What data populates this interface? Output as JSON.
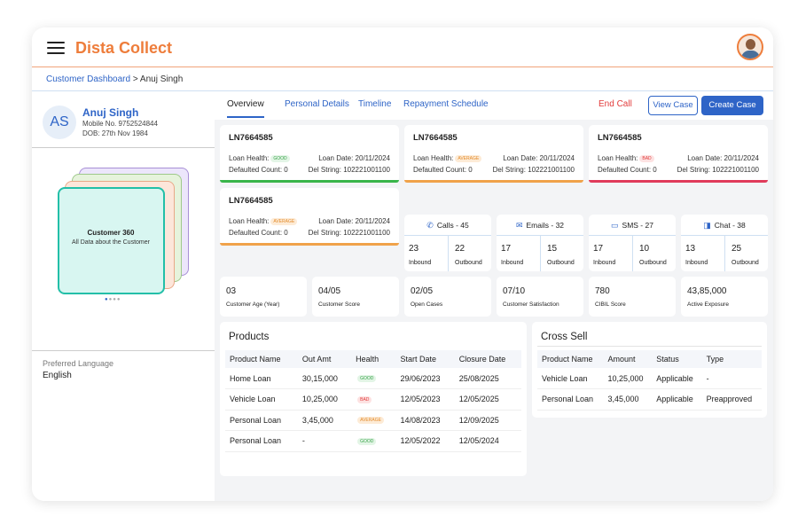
{
  "app": {
    "title": "Dista Collect"
  },
  "breadcrumb": {
    "link": "Customer Dashboard",
    "sep": " > ",
    "current": "Anuj Singh"
  },
  "customer": {
    "initials": "AS",
    "name": "Anuj Singh",
    "mobile": "Mobile No. 9752524844",
    "dob": "DOB: 27th Nov 1984"
  },
  "card360": {
    "title": "Customer 360",
    "subtitle": "All Data about the Customer"
  },
  "preferred_language": {
    "label": "Preferred Language",
    "value": "English"
  },
  "tabs": [
    "Overview",
    "Personal Details",
    "Timeline",
    "Repayment Schedule"
  ],
  "actions": {
    "end_call": "End Call",
    "view_case": "View Case",
    "create_case": "Create Case"
  },
  "loans": [
    {
      "id": "LN7664585",
      "health_label": "Loan Health:",
      "health": "GOOD",
      "loan_date": "Loan Date: 20/11/2024",
      "defaulted": "Defaulted Count: 0",
      "del_string": "Del String: 102221001100",
      "bar_color": "#39b54a"
    },
    {
      "id": "LN7664585",
      "health_label": "Loan Health:",
      "health": "AVERAGE",
      "loan_date": "Loan Date: 20/11/2024",
      "defaulted": "Defaulted Count: 0",
      "del_string": "Del String: 102221001100",
      "bar_color": "#f0a24a"
    },
    {
      "id": "LN7664585",
      "health_label": "Loan Health:",
      "health": "BAD",
      "loan_date": "Loan Date: 20/11/2024",
      "defaulted": "Defaulted Count: 0",
      "del_string": "Del String: 102221001100",
      "bar_color": "#e03b5b"
    },
    {
      "id": "LN7664585",
      "health_label": "Loan Health:",
      "health": "AVERAGE",
      "loan_date": "Loan Date: 20/11/2024",
      "defaulted": "Defaulted Count: 0",
      "del_string": "Del String: 102221001100",
      "bar_color": "#f0a24a"
    }
  ],
  "channels": [
    {
      "icon": "phone-icon",
      "glyph": "✆",
      "label": "Calls - 45",
      "inbound": "23",
      "outbound": "22"
    },
    {
      "icon": "email-icon",
      "glyph": "✉",
      "label": "Emails - 32",
      "inbound": "17",
      "outbound": "15"
    },
    {
      "icon": "sms-icon",
      "glyph": "▭",
      "label": "SMS - 27",
      "inbound": "17",
      "outbound": "10"
    },
    {
      "icon": "chat-icon",
      "glyph": "◨",
      "label": "Chat - 38",
      "inbound": "13",
      "outbound": "25"
    }
  ],
  "channel_labels": {
    "inbound": "Inbound",
    "outbound": "Outbound"
  },
  "metrics": [
    {
      "value": "03",
      "label": "Customer Age (Year)"
    },
    {
      "value": "04/05",
      "label": "Customer Score"
    },
    {
      "value": "02/05",
      "label": "Open Cases"
    },
    {
      "value": "07/10",
      "label": "Customer Satisfaction"
    },
    {
      "value": "780",
      "label": "CIBIL Score"
    },
    {
      "value": "43,85,000",
      "label": "Active Exposure"
    }
  ],
  "products": {
    "title": "Products",
    "headers": [
      "Product Name",
      "Out Amt",
      "Health",
      "Start Date",
      "Closure Date"
    ],
    "rows": [
      [
        "Home Loan",
        "30,15,000",
        "GOOD",
        "29/06/2023",
        "25/08/2025"
      ],
      [
        "Vehicle Loan",
        "10,25,000",
        "BAD",
        "12/05/2023",
        "12/05/2025"
      ],
      [
        "Personal Loan",
        "3,45,000",
        "AVERAGE",
        "14/08/2023",
        "12/09/2025"
      ],
      [
        "Personal Loan",
        "-",
        "GOOD",
        "12/05/2022",
        "12/05/2024"
      ]
    ]
  },
  "cross_sell": {
    "title": "Cross Sell",
    "headers": [
      "Product Name",
      "Amount",
      "Status",
      "Type"
    ],
    "rows": [
      [
        "Vehicle Loan",
        "10,25,000",
        "Applicable",
        "-"
      ],
      [
        "Personal Loan",
        "3,45,000",
        "Applicable",
        "Preapproved"
      ]
    ]
  }
}
